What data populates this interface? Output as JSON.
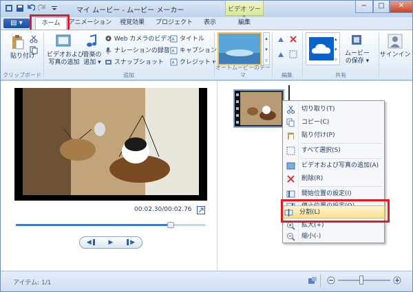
{
  "window": {
    "title": "マイ ムービー - ムービー メーカー",
    "context_tab": "ビデオ ツール",
    "minimize": "−",
    "maximize": "□",
    "close": "✕"
  },
  "tabs": [
    {
      "label": "ホーム",
      "active": true
    },
    {
      "label": "アニメーション"
    },
    {
      "label": "視覚効果"
    },
    {
      "label": "プロジェクト"
    },
    {
      "label": "表示"
    },
    {
      "label": "編集"
    }
  ],
  "file_menu": "▤ ▾",
  "ribbon": {
    "clipboard": {
      "label": "クリップボード",
      "paste": "貼り付け"
    },
    "add": {
      "label": "追加",
      "add_media": "ビデオおよび\n写真の追加",
      "add_music": "音楽の\n追加 ▾",
      "webcam": "Web カメラのビデオ",
      "narration": "ナレーションの録音 ▾",
      "snapshot": "スナップショット",
      "title": "タイトル",
      "caption": "キャプション",
      "credit": "クレジット ▾"
    },
    "automovie": {
      "label": "オートムービーのテーマ"
    },
    "edit": {
      "label": "編集"
    },
    "share": {
      "label": "共有",
      "save": "ムービー\nの保存 ▾",
      "signin": "サインイン"
    }
  },
  "preview": {
    "timecode": "00:02.30/00:02.76",
    "seek_fraction": 0.815
  },
  "context_menu": {
    "items": [
      {
        "label": "切り取り(T)",
        "icon": "scissors-icon"
      },
      {
        "label": "コピー(C)",
        "icon": "copy-icon"
      },
      {
        "label": "貼り付け(P)",
        "icon": "paste-icon"
      },
      {
        "label": "すべて選択(S)",
        "icon": "select-all-icon"
      },
      {
        "label": "ビデオおよび写真の追加(A)",
        "icon": "add-media-icon"
      },
      {
        "label": "削除(R)",
        "icon": "delete-icon"
      },
      {
        "label": "開始位置の設定(I)",
        "icon": "start-point-icon"
      },
      {
        "label": "停止位置の設定(O)",
        "icon": "end-point-icon"
      },
      {
        "label": "分割(L)",
        "icon": "split-icon"
      },
      {
        "label": "拡大(+)",
        "icon": "zoom-in-icon"
      },
      {
        "label": "縮小(-)",
        "icon": "zoom-out-icon"
      }
    ]
  },
  "status": {
    "items": "アイテム: 1/1",
    "zoom_fraction": 0.45
  },
  "colors": {
    "highlight": "#e01b24",
    "accent": "#2b5ea8"
  }
}
